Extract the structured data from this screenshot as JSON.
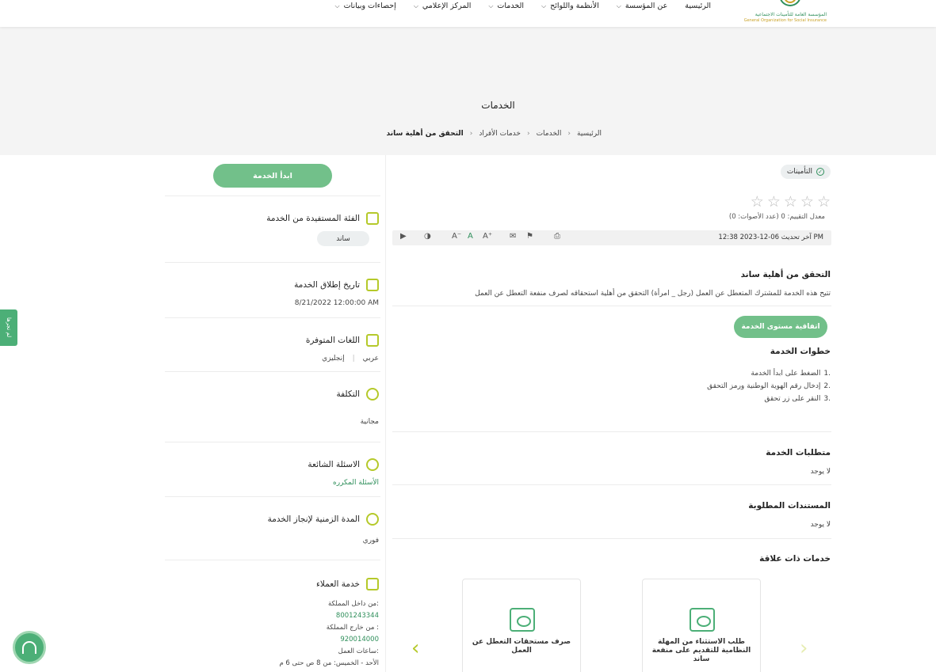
{
  "header": {
    "logo_ar": "المؤسسة العامة للتأمينات الاجتماعية",
    "logo_en": "General Organization for Social Insurance",
    "nav": [
      {
        "label": "الرئيسية",
        "has_dropdown": false
      },
      {
        "label": "عن المؤسسة",
        "has_dropdown": true
      },
      {
        "label": "الأنظمة واللوائح",
        "has_dropdown": true
      },
      {
        "label": "الخدمات",
        "has_dropdown": true
      },
      {
        "label": "المركز الإعلامي",
        "has_dropdown": true
      },
      {
        "label": "إحصاءات وبيانات",
        "has_dropdown": true
      }
    ]
  },
  "hero": {
    "title": "الخدمات",
    "breadcrumb": [
      "الرئيسية",
      "الخدمات",
      "خدمات الأفراد",
      "التحقق من أهلية ساند"
    ]
  },
  "main": {
    "badge": "التأمينات",
    "stars": [
      "☆",
      "☆",
      "☆",
      "☆",
      "☆"
    ],
    "rating_note": "معدل التقييم: 0 (عدد الأصوات: 0)",
    "last_update": "آخر تحديث 06-12-2023 12:38 PM",
    "service_title": "التحقق من أهلية ساند",
    "service_desc": "تتيح هذه الخدمة للمشترك المتعطل عن العمل (رجل _ امرأة) التحقق من أهلية استحقاقه  لصرف منفعة التعطل عن العمل",
    "sla_button": "اتفاقية مستوى الخدمة",
    "steps_title": "خطوات الخدمة",
    "steps": [
      {
        "num": "1.",
        "text": "الضغط على ابدأ الخدمة"
      },
      {
        "num": "2.",
        "text": "إدخال رقم الهوية الوطنية ورمز التحقق"
      },
      {
        "num": "3.",
        "text": "النقر على زر تحقق"
      }
    ],
    "requirements_title": "متطلبات الخدمة",
    "requirements_value": "لا يوجد",
    "documents_title": "المستندات المطلوبة",
    "documents_value": "لا يوجد",
    "related_title": "خدمات ذات علاقة",
    "related": [
      {
        "title": "طلب الاستثناء من المهلة النظامية للتقديم على منفعة ساند"
      },
      {
        "title": "صرف مستحقات التعطل عن العمل"
      }
    ],
    "arrow_prev": "›",
    "arrow_next": "‹"
  },
  "sidebar": {
    "start_button": "ابدأ الخدمة",
    "beneficiary_title": "الفئة المستفيدة من الخدمة",
    "beneficiary_value": "ساند",
    "launch_title": "تاريخ إطلاق الخدمة",
    "launch_value": "8/21/2022 12:00:00 AM",
    "languages_title": "اللغات المتوفرة",
    "languages": [
      "عربي",
      "إنجليزي"
    ],
    "cost_title": "التكلفة",
    "cost_value": "مجانية",
    "faq_title": "الاسئلة الشائعة",
    "faq_link": "الأسئلة المكرره",
    "duration_title": "المدة الزمنية لإنجاز الخدمة",
    "duration_value": "فوري",
    "customer_title": "خدمة العملاء",
    "customer_lines": [
      {
        "text": "من داخل المملكة:",
        "link": false
      },
      {
        "text": "8001243344",
        "link": true
      },
      {
        "text": "من خارج المملكة :",
        "link": false
      },
      {
        "text": "920014000",
        "link": true
      },
      {
        "text": "ساعات العمل:",
        "link": false
      },
      {
        "text": "الأحد - الخميس: من 8 ص حتى 6 م",
        "link": false
      }
    ]
  },
  "floating": {
    "side_tab": "لم تجرها",
    "support": "support-chat"
  },
  "colors": {
    "accent_green": "#72c08a",
    "brand_green": "#2f8f5b",
    "icon_lime": "#b5c92a"
  }
}
